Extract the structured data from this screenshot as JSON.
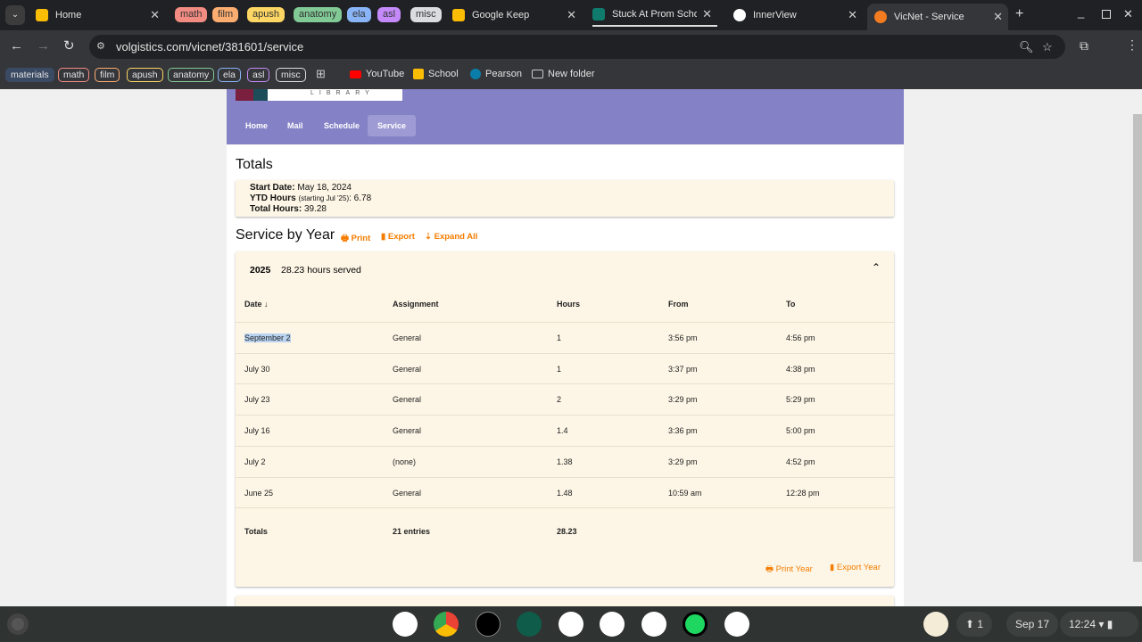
{
  "browser": {
    "tabs": [
      {
        "label": "Home"
      },
      {
        "label": "Google Keep"
      },
      {
        "label": "Stuck At Prom Scholar"
      },
      {
        "label": "InnerView"
      },
      {
        "label": "VicNet - Service"
      }
    ],
    "tab_groups": [
      {
        "label": "math",
        "color": "#f28b82"
      },
      {
        "label": "film",
        "color": "#fcad70"
      },
      {
        "label": "apush",
        "color": "#fdd663"
      },
      {
        "label": "anatomy",
        "color": "#81c995"
      },
      {
        "label": "ela",
        "color": "#8ab4f8"
      },
      {
        "label": "asl",
        "color": "#c58af9"
      },
      {
        "label": "misc",
        "color": "#dadce0"
      }
    ],
    "url": "volgistics.com/vicnet/381601/service",
    "bookmark_groups": [
      {
        "label": "materials",
        "color": "#8ab4f8"
      },
      {
        "label": "math",
        "color": "#f28b82"
      },
      {
        "label": "film",
        "color": "#fcad70"
      },
      {
        "label": "apush",
        "color": "#fdd663"
      },
      {
        "label": "anatomy",
        "color": "#81c995"
      },
      {
        "label": "ela",
        "color": "#8ab4f8"
      },
      {
        "label": "asl",
        "color": "#c58af9"
      },
      {
        "label": "misc",
        "color": "#dadce0"
      }
    ],
    "bookmarks": [
      {
        "label": "YouTube"
      },
      {
        "label": "School"
      },
      {
        "label": "Pearson"
      },
      {
        "label": "New folder"
      }
    ]
  },
  "site": {
    "logo_text": "LIBRARY",
    "nav": [
      "Home",
      "Mail",
      "Schedule",
      "Service"
    ],
    "totals_title": "Totals",
    "start_date_label": "Start Date:",
    "start_date": "May 18, 2024",
    "ytd_label": "YTD Hours",
    "ytd_note": "(starting Jul '25)",
    "ytd_value": ": 6.78",
    "total_label": "Total Hours:",
    "total_value": "39.28",
    "service_title": "Service by Year",
    "print": "Print",
    "export": "Export",
    "expand_all": "Expand All",
    "year": "2025",
    "year_summary": "28.23 hours served",
    "columns": [
      "Date ↓",
      "Assignment",
      "Hours",
      "From",
      "To"
    ],
    "rows": [
      [
        "September 2",
        "General",
        "1",
        "3:56 pm",
        "4:56 pm"
      ],
      [
        "July 30",
        "General",
        "1",
        "3:37 pm",
        "4:38 pm"
      ],
      [
        "July 23",
        "General",
        "2",
        "3:29 pm",
        "5:29 pm"
      ],
      [
        "July 16",
        "General",
        "1.4",
        "3:36 pm",
        "5:00 pm"
      ],
      [
        "July 2",
        "(none)",
        "1.38",
        "3:29 pm",
        "4:52 pm"
      ],
      [
        "June 25",
        "General",
        "1.48",
        "10:59 am",
        "12:28 pm"
      ]
    ],
    "totals_row": [
      "Totals",
      "21 entries",
      "28.23"
    ],
    "print_year": "Print Year",
    "export_year": "Export Year"
  },
  "shelf": {
    "date": "Sep 17",
    "time": "12:24",
    "notifications": "1"
  }
}
